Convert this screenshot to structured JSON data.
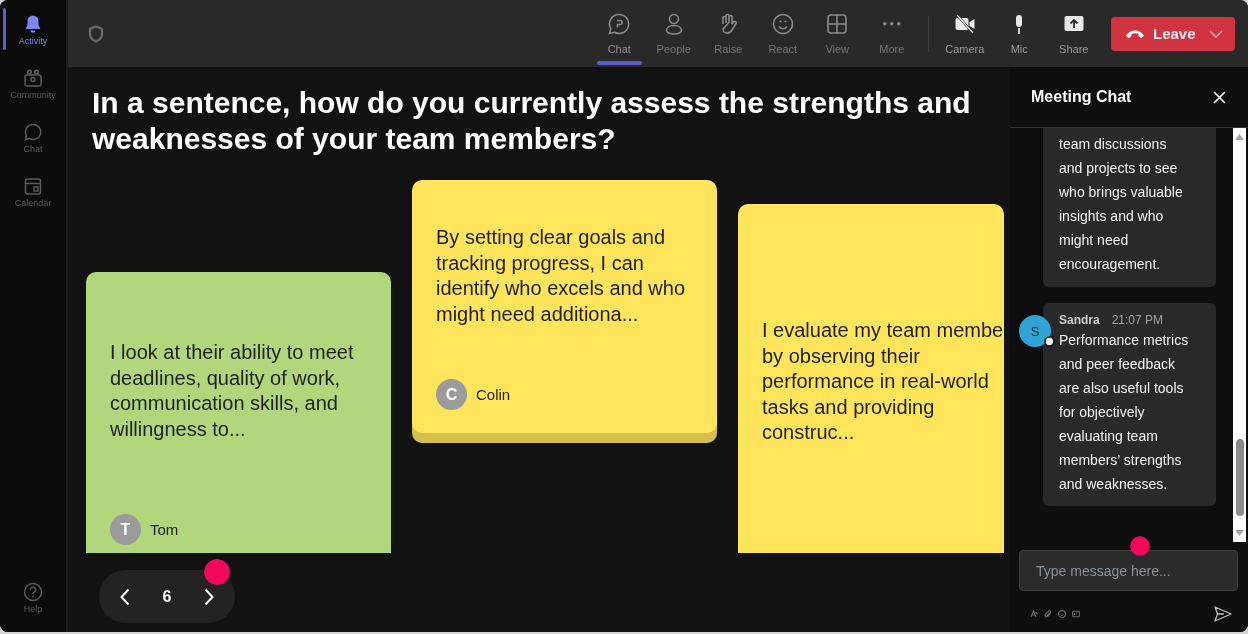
{
  "sidebar": {
    "items": [
      {
        "label": "Activity",
        "selected": true
      },
      {
        "label": "Community",
        "selected": false
      },
      {
        "label": "Chat",
        "selected": false
      },
      {
        "label": "Calendar",
        "selected": false
      }
    ],
    "help": {
      "label": "Help"
    }
  },
  "toolbar": {
    "items": [
      {
        "label": "Chat",
        "selected": true
      },
      {
        "label": "People",
        "selected": false
      },
      {
        "label": "Raise",
        "selected": false
      },
      {
        "label": "React",
        "selected": false
      },
      {
        "label": "View",
        "selected": false
      },
      {
        "label": "More",
        "selected": false
      }
    ],
    "media": [
      {
        "label": "Camera"
      },
      {
        "label": "Mic"
      },
      {
        "label": "Share"
      }
    ],
    "leave": {
      "label": "Leave"
    }
  },
  "question": "In a sentence, how do you currently assess the strengths and weaknesses of your team members?",
  "cards": [
    {
      "text": "I look at their ability to meet deadlines, quality of work, communication skills, and willingness to...",
      "color": "#b1d67b",
      "author": {
        "initial": "T",
        "name": "Tom"
      }
    },
    {
      "text": "By setting clear goals and tracking progress, I can identify who excels and who might need additiona...",
      "color": "#ffe55c",
      "author": {
        "initial": "C",
        "name": "Colin"
      }
    },
    {
      "text": "I evaluate my team membe by observing their performance in real-world tasks and providing construc...",
      "color": "#ffe55c"
    }
  ],
  "pager": {
    "page": "6"
  },
  "chat": {
    "title": "Meeting Chat",
    "messages": [
      {
        "text": "team discussions and projects to see who brings valuable insights and who might need encouragement."
      },
      {
        "sender": "Sandra",
        "time": "21:07 PM",
        "initial": "S",
        "text": "Performance metrics and peer feedback are also useful tools for objectively evaluating team members’ strengths and weaknesses."
      }
    ],
    "input": {
      "placeholder": "Type message here..."
    }
  }
}
